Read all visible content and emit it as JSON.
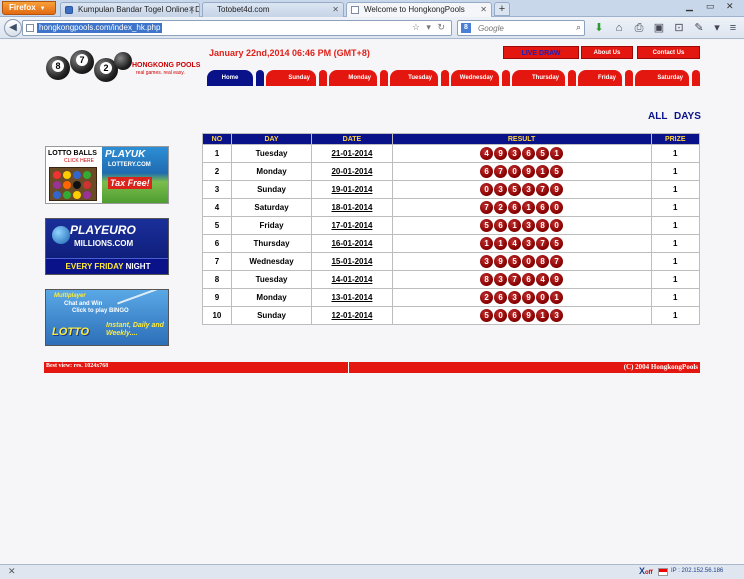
{
  "browser": {
    "firefox_label": "Firefox",
    "tabs": [
      {
        "title": "Kumpulan Bandar Togel Online | Daft..."
      },
      {
        "title": "Totobet4d.com"
      },
      {
        "title": "Welcome to HongkongPools"
      }
    ],
    "url": "hongkongpools.com/index_hk.php",
    "search_placeholder": "Google"
  },
  "header": {
    "logo_balls": [
      "8",
      "7",
      "2"
    ],
    "logo_text": "HONGKONG POOLS",
    "logo_tagline": "real games. real easy.",
    "datetime": "January 22nd,2014 06:46 PM (GMT+8)",
    "top_buttons": [
      "LIVE DRAW",
      "About Us",
      "Contact Us"
    ]
  },
  "nav": {
    "items": [
      "Home",
      "Sunday",
      "Monday",
      "Tuesday",
      "Wednesday",
      "Thursday",
      "Friday",
      "Saturday"
    ]
  },
  "section_title": "ALL DAYS",
  "table": {
    "headers": [
      "NO",
      "DAY",
      "DATE",
      "RESULT",
      "PRIZE"
    ],
    "rows": [
      {
        "no": "1",
        "day": "Tuesday",
        "date": "21-01-2014",
        "result": [
          "4",
          "9",
          "3",
          "6",
          "5",
          "1"
        ],
        "prize": "1"
      },
      {
        "no": "2",
        "day": "Monday",
        "date": "20-01-2014",
        "result": [
          "6",
          "7",
          "0",
          "9",
          "1",
          "5"
        ],
        "prize": "1"
      },
      {
        "no": "3",
        "day": "Sunday",
        "date": "19-01-2014",
        "result": [
          "0",
          "3",
          "5",
          "3",
          "7",
          "9"
        ],
        "prize": "1"
      },
      {
        "no": "4",
        "day": "Saturday",
        "date": "18-01-2014",
        "result": [
          "7",
          "2",
          "6",
          "1",
          "6",
          "0"
        ],
        "prize": "1"
      },
      {
        "no": "5",
        "day": "Friday",
        "date": "17-01-2014",
        "result": [
          "5",
          "6",
          "1",
          "3",
          "8",
          "0"
        ],
        "prize": "1"
      },
      {
        "no": "6",
        "day": "Thursday",
        "date": "16-01-2014",
        "result": [
          "1",
          "1",
          "4",
          "3",
          "7",
          "5"
        ],
        "prize": "1"
      },
      {
        "no": "7",
        "day": "Wednesday",
        "date": "15-01-2014",
        "result": [
          "3",
          "9",
          "5",
          "0",
          "8",
          "7"
        ],
        "prize": "1"
      },
      {
        "no": "8",
        "day": "Tuesday",
        "date": "14-01-2014",
        "result": [
          "8",
          "3",
          "7",
          "6",
          "4",
          "9"
        ],
        "prize": "1"
      },
      {
        "no": "9",
        "day": "Monday",
        "date": "13-01-2014",
        "result": [
          "2",
          "6",
          "3",
          "9",
          "0",
          "1"
        ],
        "prize": "1"
      },
      {
        "no": "10",
        "day": "Sunday",
        "date": "12-01-2014",
        "result": [
          "5",
          "0",
          "6",
          "9",
          "1",
          "3"
        ],
        "prize": "1"
      }
    ]
  },
  "banners": {
    "b1": {
      "title": "LOTTO BALLS",
      "click": "CLICK HERE",
      "brand": "PLAYUK",
      "brand_sub": "LOTTERY.COM",
      "tag": "Tax Free!"
    },
    "b2": {
      "brand": "PLAYEURO",
      "brand_sub": "MILLIONS.COM",
      "band_a": "EVERY FRIDAY",
      "band_b": "NIGHT"
    },
    "b3": {
      "top": "Multiplayer",
      "line1": "Chat and Win",
      "line2": "Click to play BINGO",
      "brand": "LOTTO",
      "tag": "Instant, Daily and Weekly...."
    }
  },
  "footer": {
    "left": "Best view: res. 1024x768",
    "right": "(C) 2004 HongkongPools"
  },
  "statusbar": {
    "xoff": "X",
    "xoff_suffix": "off",
    "ip": "IP : 202.152.56.186"
  },
  "colors": {
    "accent_red": "#e3170f",
    "nav_blue": "#0a128a",
    "header_yellow": "#ffd43b"
  }
}
